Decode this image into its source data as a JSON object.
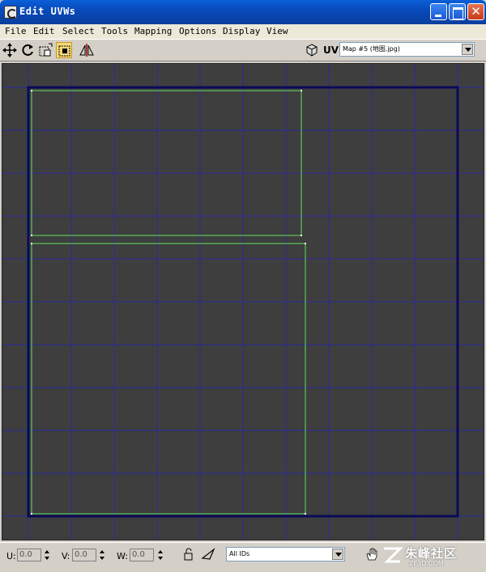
{
  "window": {
    "title": "Edit UVWs"
  },
  "menu": [
    "File",
    "Edit",
    "Select",
    "Tools",
    "Mapping",
    "Options",
    "Display",
    "View"
  ],
  "toolbar": {
    "tools": [
      "move-icon",
      "rotate-icon",
      "scale-icon",
      "freeform-icon",
      "mirror-icon"
    ],
    "active_tool": "freeform-icon",
    "uv_label": "UV",
    "map_dropdown_value": "Map #5 (地图.jpg)"
  },
  "status": {
    "u_label": "U:",
    "u_value": "0.0",
    "v_label": "V:",
    "v_value": "0.0",
    "w_label": "W:",
    "w_value": "0.0",
    "ids_dropdown_value": "All IDs"
  },
  "watermark": {
    "text": "朱峰社区",
    "sub": "ZF3D.COM"
  },
  "colors": {
    "viewport_bg": "#3e3e3e",
    "grid": "#2a2aa0",
    "uv_edge": "#5fe05f",
    "uv_bounds": "#0a0a5a"
  }
}
